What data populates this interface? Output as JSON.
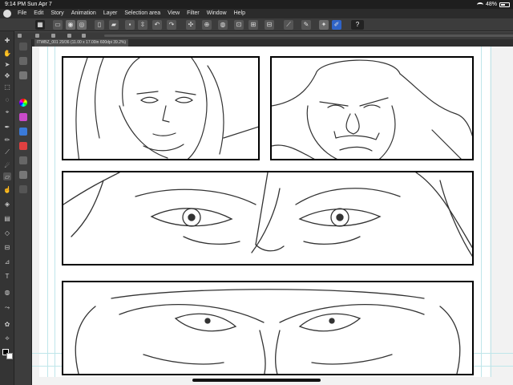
{
  "status_bar": {
    "time": "9:14 PM",
    "date": "Sun Apr 7",
    "battery": "48%"
  },
  "menu": {
    "items": [
      "File",
      "Edit",
      "Story",
      "Animation",
      "Layer",
      "Selection area",
      "View",
      "Filter",
      "Window",
      "Help"
    ]
  },
  "command_bar": {
    "help_label": "?"
  },
  "document_tab": {
    "label": "ITWBZ_001",
    "title": "ITWBZ_001 29/36 (11.00 x 17.00in 600dpi 39.2%)"
  },
  "colors": {
    "main_color": "#000000",
    "sub_color": "#ffffff",
    "accent": "#2f64c8"
  },
  "panels": [
    {
      "name": "woman-closeup",
      "art": "woman-face-sketch"
    },
    {
      "name": "ogre-closeup",
      "art": "ogre-face-sketch"
    },
    {
      "name": "eyes-closeup",
      "art": "eyes-sketch"
    },
    {
      "name": "brow-closeup",
      "art": "brow-sketch"
    }
  ]
}
